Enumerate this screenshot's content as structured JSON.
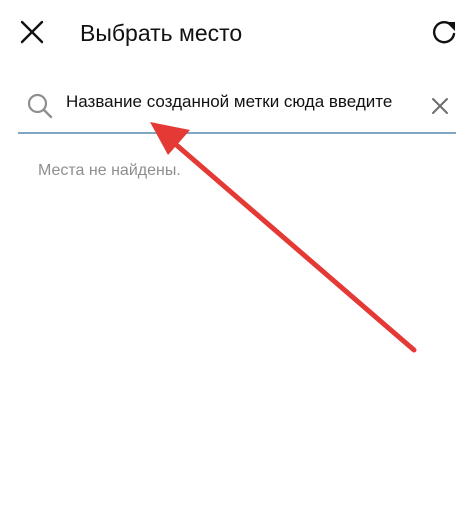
{
  "header": {
    "title": "Выбрать место",
    "close_icon": "close-icon",
    "refresh_icon": "refresh-icon"
  },
  "search": {
    "value": "Название созданной метки сюда введите",
    "icon": "search-icon",
    "clear_icon": "clear-icon"
  },
  "results": {
    "empty_message": "Места не найдены."
  },
  "colors": {
    "accent_underline": "#7fa7c4",
    "annotation_arrow": "#e53935",
    "muted_text": "#8e8e8e"
  }
}
